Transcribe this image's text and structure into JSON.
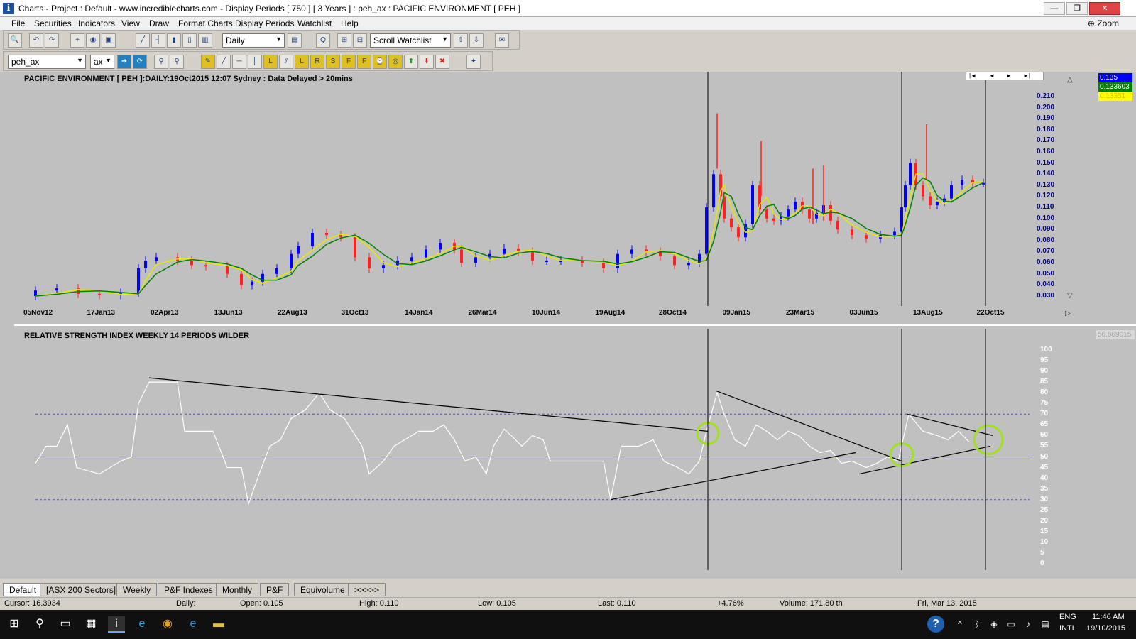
{
  "window": {
    "title": "Charts - Project : Default - www.incrediblecharts.com - Display Periods  [ 750 ]  [ 3 Years ] : peh_ax : PACIFIC ENVIRONMENT  [ PEH ]",
    "app_icon": "i",
    "minimize": "—",
    "maximize": "❐",
    "close": "✕"
  },
  "menu": {
    "items": [
      "File",
      "Securities",
      "Indicators",
      "View",
      "Draw",
      "Format Charts",
      "Display Periods",
      "Watchlist",
      "Help"
    ],
    "zoom_label": "Zoom"
  },
  "toolbar": {
    "period": "Daily",
    "watchlist": "Scroll Watchlist",
    "symbol": "peh_ax",
    "exchange": "ax"
  },
  "price_chart": {
    "title": "PACIFIC ENVIRONMENT [ PEH ]:DAILY:19Oct2015 12:07 Sydney : Data Delayed > 20mins",
    "y_ticks": [
      "0.210",
      "0.200",
      "0.190",
      "0.180",
      "0.170",
      "0.160",
      "0.150",
      "0.140",
      "0.130",
      "0.120",
      "0.110",
      "0.100",
      "0.090",
      "0.080",
      "0.070",
      "0.060",
      "0.050",
      "0.040",
      "0.030"
    ],
    "dates": [
      "05Nov12",
      "17Jan13",
      "02Apr13",
      "13Jun13",
      "22Aug13",
      "31Oct13",
      "14Jan14",
      "26Mar14",
      "10Jun14",
      "19Aug14",
      "28Oct14",
      "09Jan15",
      "23Mar15",
      "03Jun15",
      "13Aug15",
      "22Oct15"
    ],
    "last_value": "0.135",
    "ma1_value": "0.133603",
    "ma2_value": "0.13351",
    "pane_number": "1",
    "colors": {
      "up": "#0000ff",
      "down": "#ff2020",
      "ma_fast": "#e8e800",
      "ma_slow": "#008000"
    }
  },
  "rsi_chart": {
    "title": "RELATIVE STRENGTH INDEX WEEKLY 14 PERIODS WILDER",
    "value": "56.669015",
    "y_ticks": [
      "100",
      "95",
      "90",
      "85",
      "80",
      "75",
      "70",
      "65",
      "60",
      "55",
      "50",
      "45",
      "40",
      "35",
      "30",
      "25",
      "20",
      "15",
      "10",
      "5",
      "0"
    ],
    "pane_number": "1",
    "marker": "»",
    "colors": {
      "line": "#ffffff",
      "highlight": "#a0e020"
    }
  },
  "nav": {
    "first": "|◄",
    "prev": "◄",
    "next": "►",
    "last": "►|"
  },
  "tabs": [
    "Default",
    "[ASX 200 Sectors]",
    "Weekly",
    "P&F Indexes",
    "Monthly",
    "P&F",
    "Equivolume",
    ">>>>>"
  ],
  "status": {
    "cursor": "Cursor: 16.3934",
    "period": "Daily:",
    "open": "Open: 0.105",
    "high": "High: 0.110",
    "low": "Low: 0.105",
    "last": "Last: 0.110",
    "change": "+4.76%",
    "volume": "Volume: 171.80 th",
    "date": "Fri, Mar 13, 2015"
  },
  "taskbar": {
    "lang1": "ENG",
    "lang2": "INTL",
    "time": "11:46 AM",
    "date": "19/10/2015"
  }
}
